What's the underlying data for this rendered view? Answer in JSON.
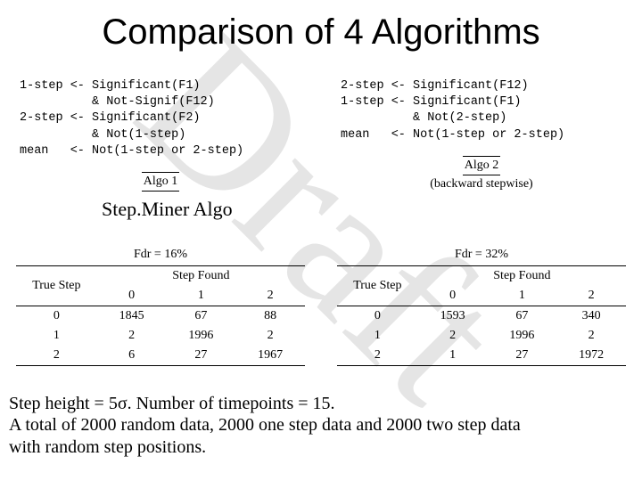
{
  "title": "Comparison of 4 Algorithms",
  "watermark": "Draft",
  "left": {
    "code": "1-step <- Significant(F1)\n          & Not-Signif(F12)\n2-step <- Significant(F2)\n          & Not(1-step)\nmean   <- Not(1-step or 2-step)",
    "algo_label": "Algo 1",
    "algo_sub": "",
    "overlay": "Step.Miner Algo",
    "fdr": "Fdr = 16%",
    "table": {
      "col_left": "True Step",
      "col_right": "Step Found",
      "subcols": [
        "0",
        "1",
        "2"
      ],
      "rows": [
        {
          "k": "0",
          "v": [
            "1845",
            "67",
            "88"
          ]
        },
        {
          "k": "1",
          "v": [
            "2",
            "1996",
            "2"
          ]
        },
        {
          "k": "2",
          "v": [
            "6",
            "27",
            "1967"
          ]
        }
      ]
    }
  },
  "right": {
    "code": "2-step <- Significant(F12)\n1-step <- Significant(F1)\n          & Not(2-step)\nmean   <- Not(1-step or 2-step)",
    "algo_label": "Algo 2",
    "algo_sub": "(backward stepwise)",
    "fdr": "Fdr = 32%",
    "table": {
      "col_left": "True Step",
      "col_right": "Step Found",
      "subcols": [
        "0",
        "1",
        "2"
      ],
      "rows": [
        {
          "k": "0",
          "v": [
            "1593",
            "67",
            "340"
          ]
        },
        {
          "k": "1",
          "v": [
            "2",
            "1996",
            "2"
          ]
        },
        {
          "k": "2",
          "v": [
            "1",
            "27",
            "1972"
          ]
        }
      ]
    }
  },
  "caption_l1": "Step height = 5σ. Number of timepoints = 15.",
  "caption_l2": "A total of 2000 random data, 2000 one step data and 2000 two step data",
  "caption_l3": "with random step positions."
}
